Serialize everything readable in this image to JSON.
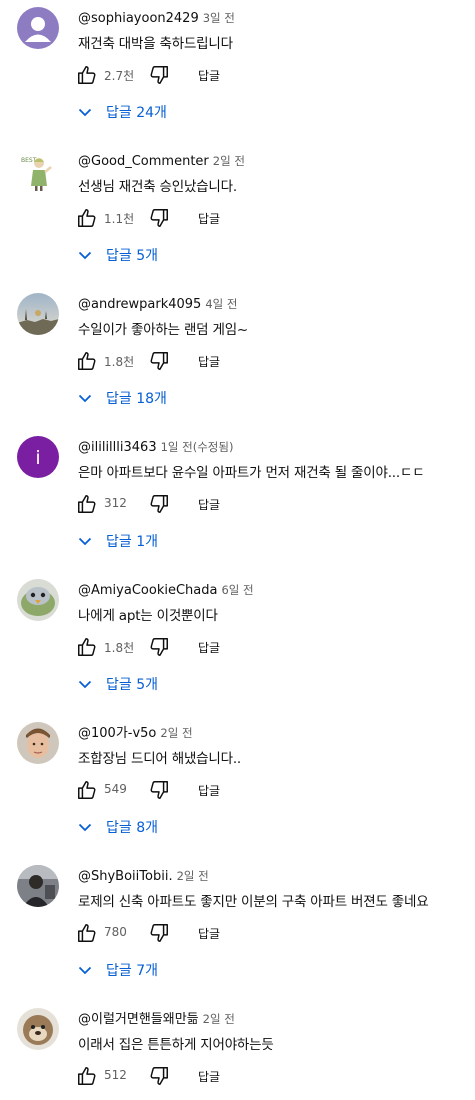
{
  "colors": {
    "link": "#065fd4",
    "meta": "#606060",
    "text": "#0f0f0f"
  },
  "comments": [
    {
      "author": "@sophiayoon2429",
      "time": "3일 전",
      "text": "재건축 대박을 축하드립니다",
      "likes": "2.7천",
      "reply_label": "답글",
      "replies": "답글 24개",
      "avatar": "default-avatar"
    },
    {
      "author": "@Good_Commenter",
      "time": "2일 전",
      "text": "선생님 재건축 승인났습니다.",
      "likes": "1.1천",
      "reply_label": "답글",
      "replies": "답글 5개",
      "avatar": "character-avatar"
    },
    {
      "author": "@andrewpark4095",
      "time": "4일 전",
      "text": "수일이가 좋아하는 랜덤 게임~",
      "likes": "1.8천",
      "reply_label": "답글",
      "replies": "답글 18개",
      "avatar": "landscape-avatar"
    },
    {
      "author": "@ililillli3463",
      "time": "1일 전(수정됨)",
      "text": "은마 아파트보다 윤수일 아파트가 먼저 재건축 될 줄이야...ㄷㄷ",
      "likes": "312",
      "reply_label": "답글",
      "replies": "답글 1개",
      "avatar": "letter-avatar",
      "avatar_letter": "i"
    },
    {
      "author": "@AmiyaCookieChada",
      "time": "6일 전",
      "text": "나에게 apt는 이것뿐이다",
      "likes": "1.8천",
      "reply_label": "답글",
      "replies": "답글 5개",
      "avatar": "bird-avatar"
    },
    {
      "author": "@100가-v5o",
      "time": "2일 전",
      "text": "조합장님 드디어 해냈습니다..",
      "likes": "549",
      "reply_label": "답글",
      "replies": "답글 8개",
      "avatar": "person-avatar"
    },
    {
      "author": "@ShyBoiiTobii.",
      "time": "2일 전",
      "text": "로제의 신축 아파트도 좋지만 이분의 구축 아파트 버젼도 좋네요",
      "likes": "780",
      "reply_label": "답글",
      "replies": "답글 7개",
      "avatar": "photo-avatar"
    },
    {
      "author": "@이럴거면핸들왜만듦",
      "time": "2일 전",
      "text": "이래서 집은 튼튼하게 지어야하는듯",
      "likes": "512",
      "reply_label": "답글",
      "replies": "",
      "avatar": "animal-avatar"
    }
  ]
}
